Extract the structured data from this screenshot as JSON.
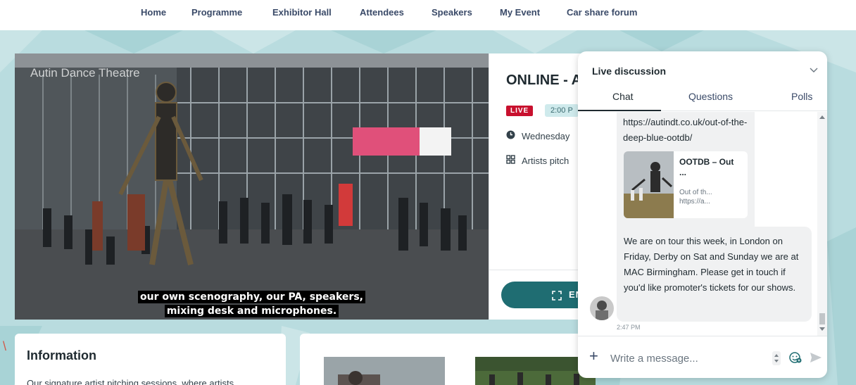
{
  "nav": {
    "items": [
      {
        "label": "Home"
      },
      {
        "label": "Programme"
      },
      {
        "label": "Exhibitor Hall"
      },
      {
        "label": "Attendees"
      },
      {
        "label": "Speakers"
      },
      {
        "label": "My Event"
      },
      {
        "label": "Car share forum"
      }
    ]
  },
  "video": {
    "watermark": "Autin Dance Theatre",
    "caption_line1": "our own scenography, our PA, speakers,",
    "caption_line2": "mixing desk and microphones."
  },
  "session": {
    "title": "ONLINE - A",
    "live_label": "LIVE",
    "time": "2:00 P",
    "date": "Wednesday",
    "track": "Artists pitch",
    "enter_label": "EN",
    "date_icon": "clock-icon",
    "track_icon": "grid-icon"
  },
  "info": {
    "title": "Information",
    "description": "Our signature artist pitching sessions, where artists"
  },
  "chat": {
    "title": "Live discussion",
    "tabs": [
      {
        "label": "Chat"
      },
      {
        "label": "Questions"
      },
      {
        "label": "Polls"
      }
    ],
    "link_text": "https://autindt.co.uk/out-of-the-deep-blue-ootdb/",
    "preview": {
      "title": "OOTDB – Out ...",
      "description": "Out of th... https://a..."
    },
    "message": "We are on tour this week, in London on Friday, Derby on Sat and Sunday we are at MAC Birmingham. Please get in touch if you'd like promoter's tickets for our shows.",
    "time": "2:47 PM",
    "input_placeholder": "Write a message..."
  },
  "colors": {
    "accent": "#1f6d72",
    "live": "#c8102e",
    "nav_text": "#3a4a68",
    "stage_bg": "#b9dcdf"
  }
}
